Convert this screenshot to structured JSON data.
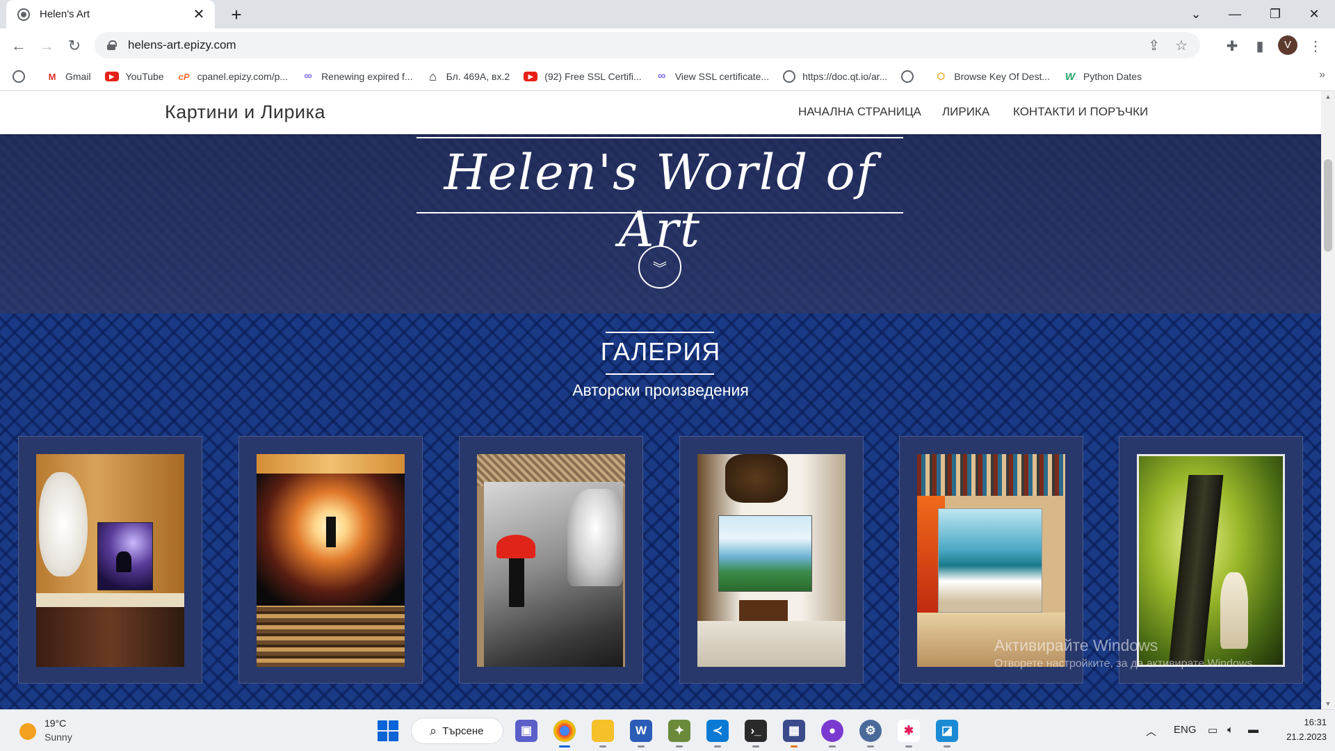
{
  "browser": {
    "tab_title": "Helen's Art",
    "url": "helens-art.epizy.com",
    "profile_initial": "V",
    "bookmarks": [
      {
        "label": "",
        "icon": "globe-icon"
      },
      {
        "label": "Gmail",
        "icon": "gmail-icon"
      },
      {
        "label": "YouTube",
        "icon": "youtube-icon"
      },
      {
        "label": "cpanel.epizy.com/p...",
        "icon": "cpanel-icon"
      },
      {
        "label": "Renewing expired f...",
        "icon": "infinity-icon"
      },
      {
        "label": "Бл. 469А, вх.2",
        "icon": "home-icon"
      },
      {
        "label": "(92) Free SSL Certifi...",
        "icon": "youtube-icon"
      },
      {
        "label": "View SSL certificate...",
        "icon": "infinity-icon"
      },
      {
        "label": "https://doc.qt.io/ar...",
        "icon": "globe-icon"
      },
      {
        "label": "",
        "icon": "globe-icon"
      },
      {
        "label": "Browse Key Of Dest...",
        "icon": "shield-icon"
      },
      {
        "label": "Python Dates",
        "icon": "w-icon"
      }
    ],
    "more_bookmarks": "»"
  },
  "site": {
    "brand": "Картини и Лирика",
    "nav": [
      "НАЧАЛНА СТРАНИЦА",
      "ЛИРИКА",
      "КОНТАКТИ И ПОРЪЧКИ"
    ],
    "hero_title": "Helen's World of Art",
    "gallery_title": "ГАЛЕРИЯ",
    "gallery_subtitle": "Авторски произведения",
    "gallery_items": [
      {
        "subject": "seashell and wolf painting"
      },
      {
        "subject": "deer at sunset painting"
      },
      {
        "subject": "couple with red umbrella painting"
      },
      {
        "subject": "mountain lake painting"
      },
      {
        "subject": "ocean wave painting"
      },
      {
        "subject": "woman under tree painting"
      }
    ]
  },
  "windows_watermark": {
    "line1": "Активирайте Windows",
    "line2": "Отворете настройките, за да активирате Windows."
  },
  "taskbar": {
    "temperature": "19°C",
    "weather": "Sunny",
    "search_label": "Търсене",
    "language": "ENG",
    "time": "16:31",
    "date": "21.2.2023"
  },
  "colors": {
    "hero_bg": "#263466",
    "gallery_bg": "#1a3a86",
    "card_bg": "#29386a",
    "accent_white": "#ffffff"
  }
}
